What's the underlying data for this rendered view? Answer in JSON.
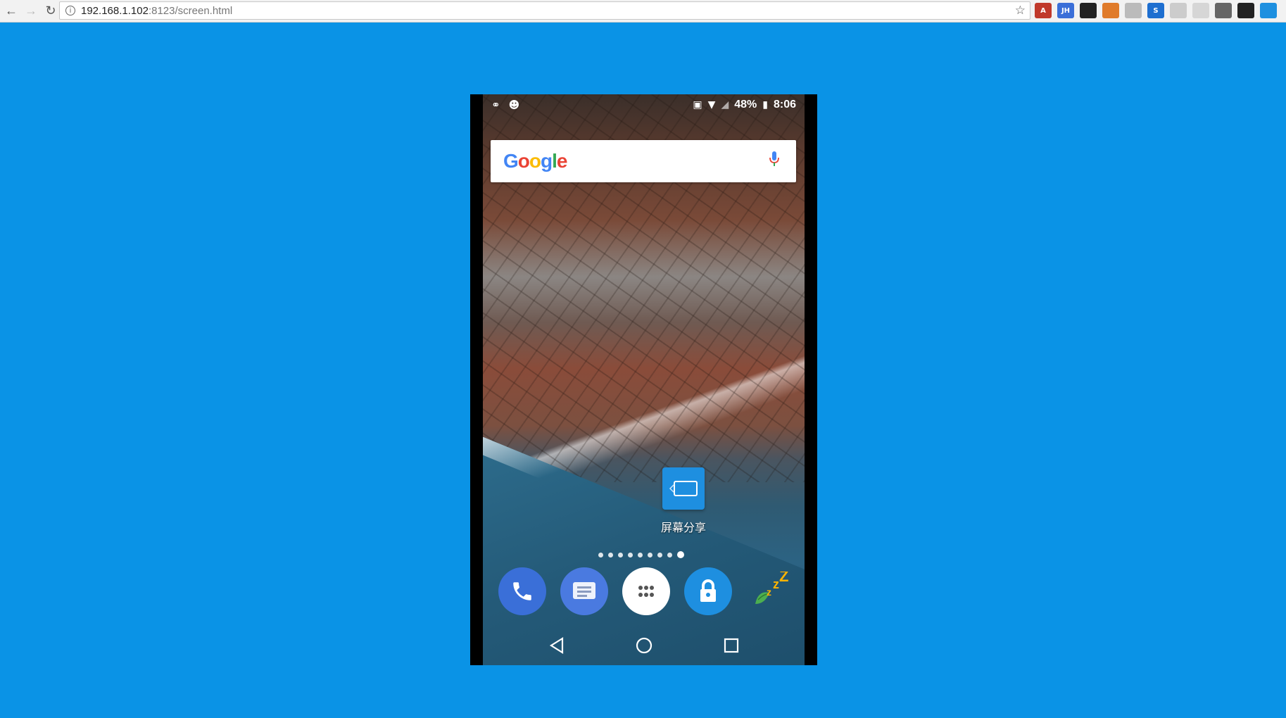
{
  "browser": {
    "back_icon": "arrow-left-icon",
    "forward_icon": "arrow-right-icon",
    "reload_icon": "reload-icon",
    "url_host": "192.168.1.102",
    "url_path": ":8123/screen.html",
    "bookmark_icon": "star-icon",
    "extensions": [
      {
        "name": "acrobat-extension-icon",
        "label": "A",
        "color": "#c0392b"
      },
      {
        "name": "jh-extension-icon",
        "label": "JH",
        "color": "#3b6fd8"
      },
      {
        "name": "glasses-extension-icon",
        "label": "",
        "color": "#222222"
      },
      {
        "name": "orange-extension-icon",
        "label": "",
        "color": "#e07b2a"
      },
      {
        "name": "grey-a-extension-icon",
        "label": "",
        "color": "#bbbbbb"
      },
      {
        "name": "s-extension-icon",
        "label": "S",
        "color": "#1e6fd0"
      },
      {
        "name": "shield-extension-icon",
        "label": "",
        "color": "#cccccc"
      },
      {
        "name": "grey-extension-icon",
        "label": "",
        "color": "#d6d6d6"
      },
      {
        "name": "gear-extension-icon",
        "label": "",
        "color": "#666666"
      },
      {
        "name": "toggle-extension-icon",
        "label": "",
        "color": "#222222"
      },
      {
        "name": "blue-extension-icon",
        "label": "",
        "color": "#1e90e0"
      }
    ]
  },
  "phone": {
    "status": {
      "battery_percent": "48%",
      "time": "8:06"
    },
    "google_bar": {
      "logo_letters": [
        "G",
        "o",
        "o",
        "g",
        "l",
        "e"
      ],
      "logo_colors": [
        "#4285f4",
        "#ea4335",
        "#fbbc05",
        "#4285f4",
        "#34a853",
        "#ea4335"
      ]
    },
    "shortcut": {
      "label": "屏幕分享",
      "color": "#1e8fe0"
    },
    "page_indicator": {
      "count": 9,
      "active_index": 8
    },
    "dock": [
      {
        "name": "phone-app-icon",
        "color": "#3a6fd8"
      },
      {
        "name": "messages-app-icon",
        "color": "#4a7ae0"
      },
      {
        "name": "app-drawer-icon",
        "color": "#ffffff"
      },
      {
        "name": "lock-app-icon",
        "color": "#1e8fe0"
      },
      {
        "name": "sleep-app-icon",
        "color": "#4caf50"
      }
    ]
  },
  "colors": {
    "page_background": "#0a93e6"
  }
}
